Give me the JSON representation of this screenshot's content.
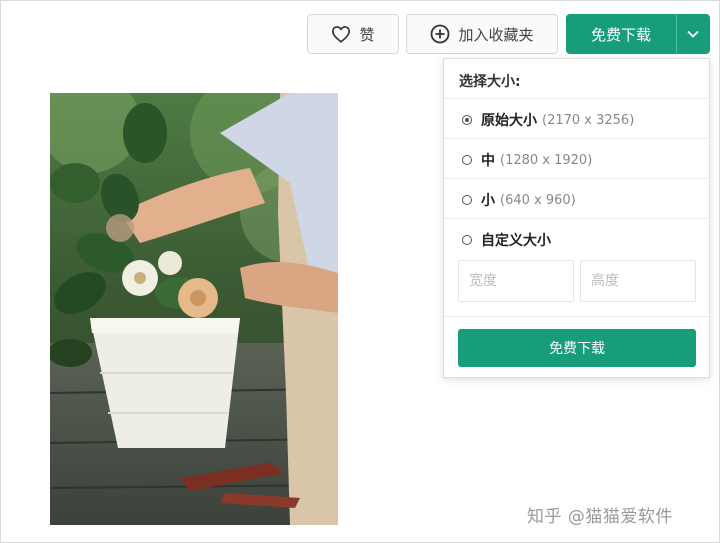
{
  "toolbar": {
    "like_label": "赞",
    "favorite_label": "加入收藏夹",
    "download_label": "免费下载"
  },
  "size_panel": {
    "title": "选择大小:",
    "options": [
      {
        "label": "原始大小",
        "dims": "(2170 x 3256)",
        "selected": true
      },
      {
        "label": "中",
        "dims": "(1280 x 1920)",
        "selected": false
      },
      {
        "label": "小",
        "dims": "(640 x 960)",
        "selected": false
      },
      {
        "label": "自定义大小",
        "dims": "",
        "selected": false
      }
    ],
    "width_placeholder": "宽度",
    "height_placeholder": "高度",
    "download_label": "免费下载"
  },
  "watermark": "知乎 @猫猫爱软件",
  "colors": {
    "accent": "#189d7a"
  }
}
